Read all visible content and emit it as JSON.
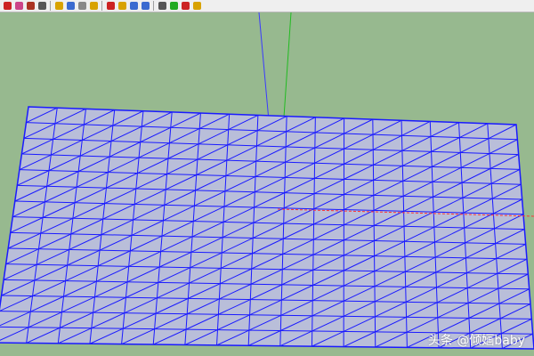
{
  "colors": {
    "background": "#97b98f",
    "mesh_line": "#1a1aff",
    "mesh_fill": "#b9bed9",
    "axis_blue": "#3a3aff",
    "axis_green": "#22bb22",
    "axis_red": "#ff3333"
  },
  "toolbar": {
    "groups": [
      [
        {
          "name": "select-icon",
          "color": "#cc2222"
        },
        {
          "name": "eraser-icon",
          "color": "#cc4488"
        },
        {
          "name": "paint-bucket-icon",
          "color": "#aa3322"
        },
        {
          "name": "follow-me-icon",
          "color": "#555555"
        }
      ],
      [
        {
          "name": "tape-measure-icon",
          "color": "#d8a200"
        },
        {
          "name": "dimension-icon",
          "color": "#3a6ad0"
        },
        {
          "name": "protractor-icon",
          "color": "#888888"
        },
        {
          "name": "text-tool-icon",
          "color": "#d8a200"
        }
      ],
      [
        {
          "name": "orbit-icon",
          "color": "#cc2222"
        },
        {
          "name": "pan-icon",
          "color": "#d8a200"
        },
        {
          "name": "zoom-icon",
          "color": "#3a6ad0"
        },
        {
          "name": "zoom-extents-icon",
          "color": "#3a6ad0"
        }
      ],
      [
        {
          "name": "components-icon",
          "color": "#555555"
        },
        {
          "name": "materials-icon",
          "color": "#22aa22"
        },
        {
          "name": "layers-icon",
          "color": "#cc2222"
        },
        {
          "name": "styles-icon",
          "color": "#d8a200"
        }
      ]
    ]
  },
  "watermark": "头条 @倾婳baby"
}
